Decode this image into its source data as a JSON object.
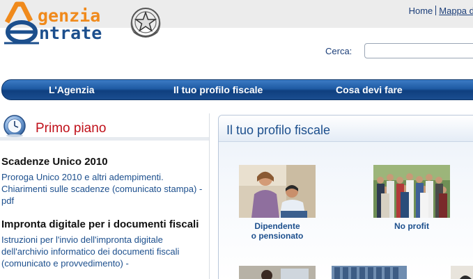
{
  "topbar": {
    "home_link": "Home",
    "map_link": "Mappa del"
  },
  "logo": {
    "line1": "genzia",
    "line2": "ntrate"
  },
  "search": {
    "label": "Cerca:",
    "value": ""
  },
  "nav": {
    "items": [
      "L'Agenzia",
      "Il tuo profilo fiscale",
      "Cosa devi fare"
    ]
  },
  "primo_piano": {
    "title": "Primo piano",
    "news": [
      {
        "title": "Scadenze Unico 2010",
        "text": "Proroga Unico 2010 e altri adempimenti. Chiarimenti sulle scadenze (comunicato stampa) - pdf"
      },
      {
        "title": "Impronta digitale per i documenti fiscali",
        "text": "Istruzioni per l'invio dell'impronta digitale dell'archivio informatico dei documenti fiscali (comunicato e provvedimento) -"
      }
    ]
  },
  "profilo": {
    "title": "Il tuo profilo fiscale",
    "cards": [
      {
        "caption": "Dipendente\no pensionato"
      },
      {
        "caption": "No profit"
      }
    ]
  },
  "colors": {
    "brand_blue": "#1c4f8d",
    "brand_orange": "#f08a1c",
    "accent_red": "#c0101a"
  }
}
